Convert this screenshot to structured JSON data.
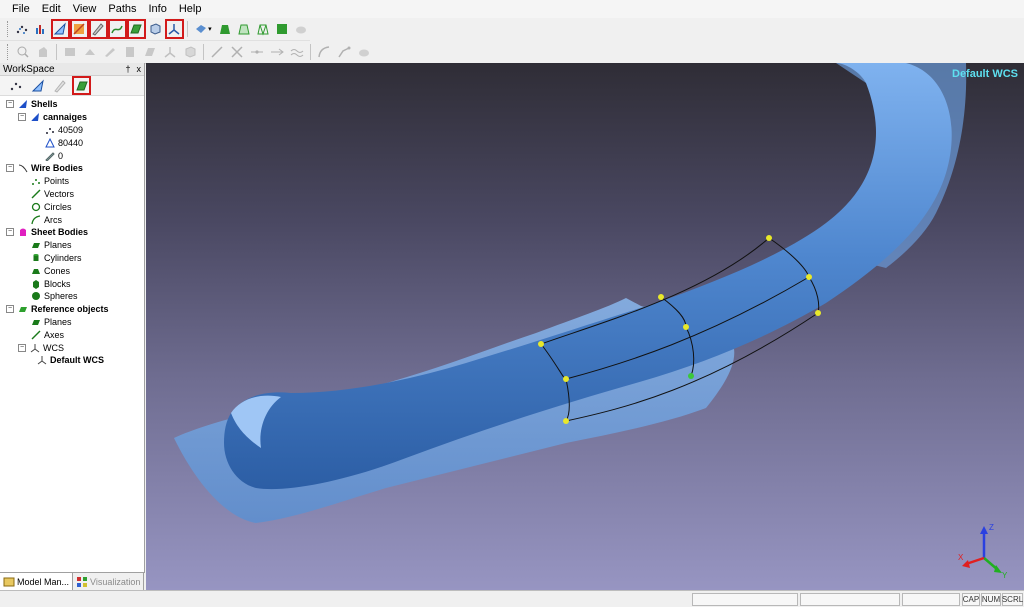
{
  "menu": {
    "file": "File",
    "edit": "Edit",
    "view": "View",
    "paths": "Paths",
    "info": "Info",
    "help": "Help"
  },
  "workspace": {
    "title": "WorkSpace",
    "pin": "†",
    "close": "x"
  },
  "tree": {
    "shells": "Shells",
    "cannaiges": "cannaiges",
    "points_count": "40509",
    "triangles_count": "80440",
    "edges_count": "0",
    "wire_bodies": "Wire Bodies",
    "points": "Points",
    "vectors": "Vectors",
    "circles": "Circles",
    "arcs": "Arcs",
    "sheet_bodies": "Sheet Bodies",
    "planes": "Planes",
    "cylinders": "Cylinders",
    "cones": "Cones",
    "blocks": "Blocks",
    "spheres": "Spheres",
    "reference_objects": "Reference objects",
    "ref_planes": "Planes",
    "axes": "Axes",
    "wcs": "WCS",
    "default_wcs": "Default WCS"
  },
  "tabs": {
    "model_manager": "Model Man...",
    "visualization": "Visualization"
  },
  "viewport": {
    "wcs_label": "Default WCS",
    "axis_z": "Z",
    "axis_y": "Y",
    "axis_x": "X"
  },
  "status": {
    "cap": "CAP",
    "num": "NUM",
    "scrl": "SCRL"
  },
  "colors": {
    "mesh": "#5b8fd0",
    "accent_red": "#d21a1a",
    "label_cyan": "#5ee0f0"
  }
}
